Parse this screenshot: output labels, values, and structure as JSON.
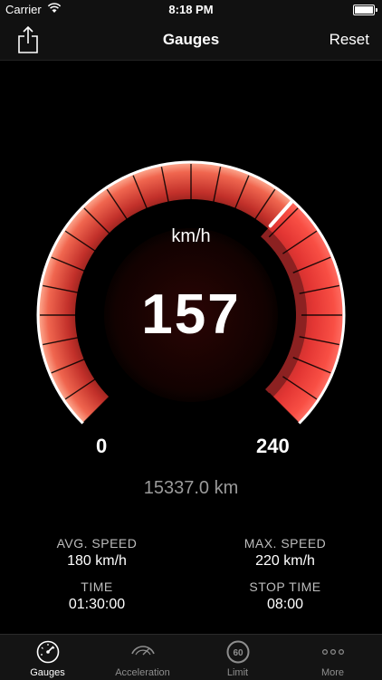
{
  "status_bar": {
    "carrier": "Carrier",
    "time": "8:18 PM"
  },
  "nav": {
    "title": "Gauges",
    "reset_label": "Reset"
  },
  "gauge": {
    "unit": "km/h",
    "speed": "157",
    "speed_value": 157,
    "min_label": "0",
    "max_label": "240",
    "max_value": 240,
    "odometer": "15337.0 km",
    "colors": {
      "low": "#a01c1a",
      "mid": "#e5503f",
      "high": "#ff7a5c",
      "limit_zone": "#ff3d3d",
      "needle": "#ffffff"
    }
  },
  "stats": {
    "avg_speed": {
      "label": "AVG. SPEED",
      "value": "180 km/h"
    },
    "max_speed": {
      "label": "MAX. SPEED",
      "value": "220 km/h"
    },
    "time": {
      "label": "TIME",
      "value": "01:30:00"
    },
    "stop_time": {
      "label": "STOP TIME",
      "value": "08:00"
    }
  },
  "tabs": [
    {
      "label": "Gauges",
      "icon": "speedometer-icon",
      "active": true
    },
    {
      "label": "Acceleration",
      "icon": "acceleration-icon",
      "active": false
    },
    {
      "label": "Limit",
      "icon": "speed-limit-icon",
      "limit_text": "60",
      "active": false
    },
    {
      "label": "More",
      "icon": "more-icon",
      "active": false
    }
  ]
}
